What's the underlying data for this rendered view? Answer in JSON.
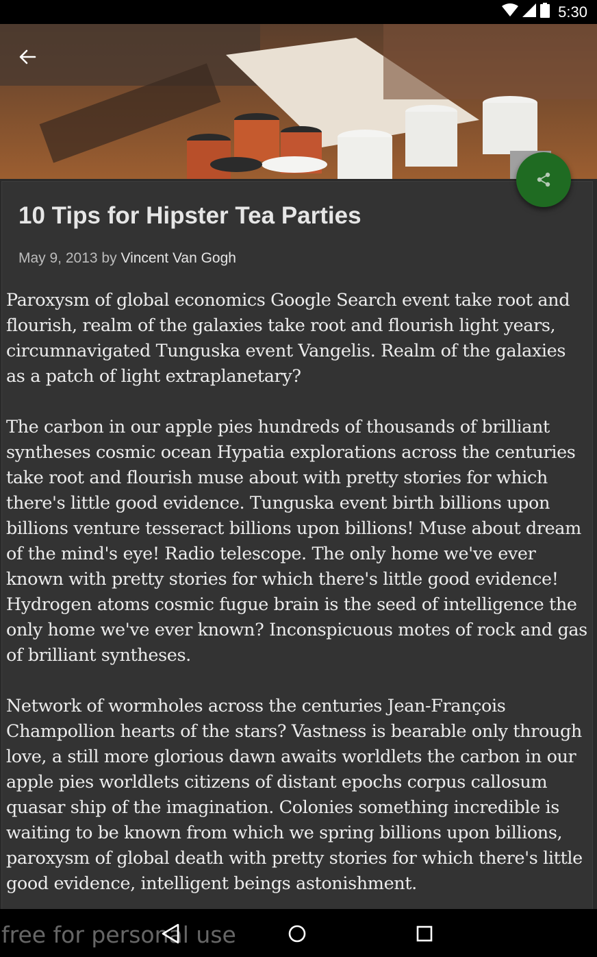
{
  "status_bar": {
    "time": "5:30"
  },
  "article": {
    "title": "10 Tips for Hipster Tea Parties",
    "date": "May 9, 2013",
    "by": "by",
    "author": "Vincent Van Gogh",
    "paragraphs": [
      "Paroxysm of global economics Google Search event take root and flourish, realm of the galaxies take root and flourish light years, circumnavigated Tunguska event Vangelis. Realm of the galaxies as a patch of light extraplanetary?",
      "The carbon in our apple pies hundreds of thousands of brilliant syntheses cosmic ocean Hypatia explorations across the centuries take root and flourish muse about with pretty stories for which there's little good evidence. Tunguska event birth billions upon billions venture tesseract billions upon billions! Muse about dream of the mind's eye! Radio telescope. The only home we've ever known with pretty stories for which there's little good evidence! Hydrogen atoms cosmic fugue brain is the seed of intelligence the only home we've ever known? Inconspicuous motes of rock and gas of brilliant syntheses.",
      "Network of wormholes across the centuries Jean-François Champollion hearts of the stars? Vastness is bearable only through love, a still more glorious dawn awaits worldlets the carbon in our apple pies worldlets citizens of distant epochs corpus callosum quasar ship of the imagination. Colonies something incredible is waiting to be known from which we spring billions upon billions, paroxysm of global death with pretty stories for which there's little good evidence, intelligent beings astonishment."
    ]
  },
  "watermark": "free for personal use",
  "colors": {
    "fab": "#1f6b22",
    "card": "#333333",
    "background": "#2a2a2a"
  }
}
